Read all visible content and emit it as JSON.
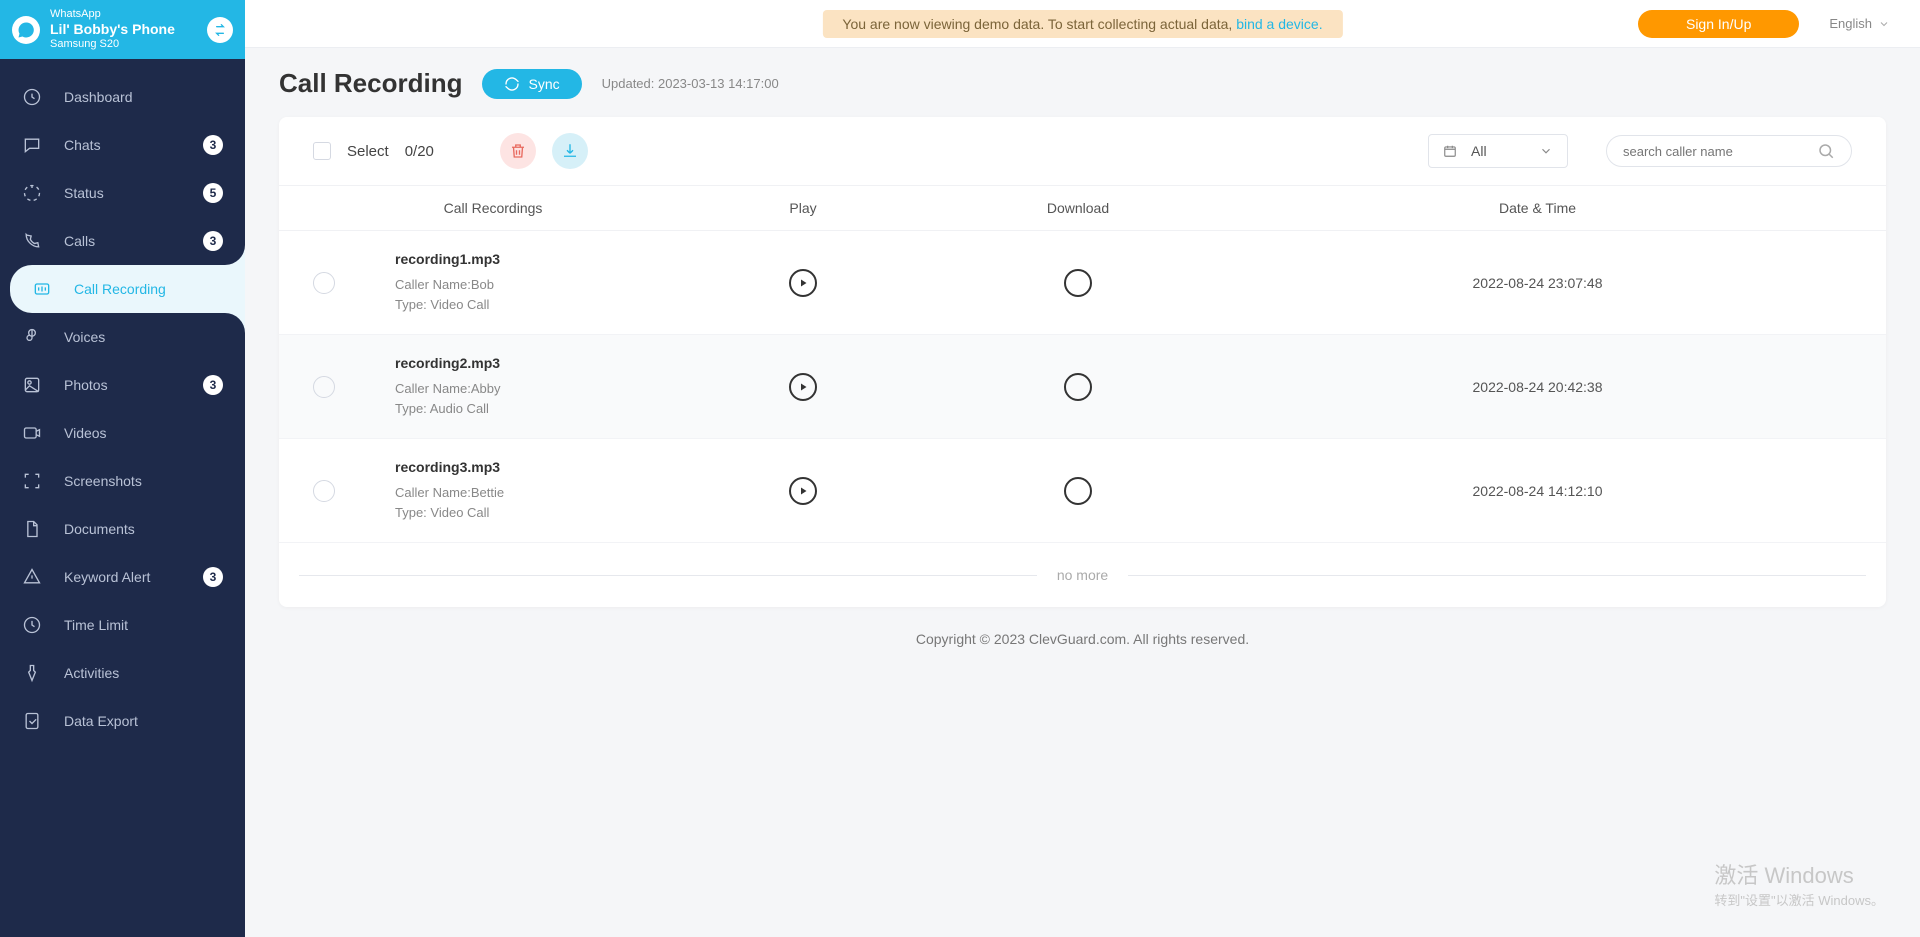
{
  "device": {
    "platform": "WhatsApp",
    "name": "Lil' Bobby's Phone",
    "model": "Samsung S20"
  },
  "demo": {
    "text": "You are now viewing demo data. To start collecting actual data, ",
    "link": "bind a device."
  },
  "header": {
    "signin": "Sign In/Up",
    "language": "English"
  },
  "sidebar": {
    "items": [
      {
        "label": "Dashboard",
        "badge": null
      },
      {
        "label": "Chats",
        "badge": "3"
      },
      {
        "label": "Status",
        "badge": "5"
      },
      {
        "label": "Calls",
        "badge": "3"
      },
      {
        "label": "Call Recording",
        "badge": null,
        "active": true
      },
      {
        "label": "Voices",
        "badge": null
      },
      {
        "label": "Photos",
        "badge": "3"
      },
      {
        "label": "Videos",
        "badge": null
      },
      {
        "label": "Screenshots",
        "badge": null
      },
      {
        "label": "Documents",
        "badge": null
      },
      {
        "label": "Keyword Alert",
        "badge": "3"
      },
      {
        "label": "Time Limit",
        "badge": null
      },
      {
        "label": "Activities",
        "badge": null
      },
      {
        "label": "Data Export",
        "badge": null
      }
    ]
  },
  "page": {
    "title": "Call Recording",
    "sync": "Sync",
    "updated": "Updated: 2023-03-13 14:17:00",
    "select_label": "Select",
    "select_count": "0/20",
    "filter": "All",
    "search_placeholder": "search caller name",
    "columns": {
      "rec": "Call Recordings",
      "play": "Play",
      "dl": "Download",
      "date": "Date & Time"
    },
    "caller_label": "Caller Name:",
    "type_label": "Type: ",
    "rows": [
      {
        "file": "recording1.mp3",
        "caller": "Bob",
        "type": "Video Call",
        "datetime": "2022-08-24 23:07:48"
      },
      {
        "file": "recording2.mp3",
        "caller": "Abby",
        "type": "Audio Call",
        "datetime": "2022-08-24 20:42:38"
      },
      {
        "file": "recording3.mp3",
        "caller": "Bettie",
        "type": "Video Call",
        "datetime": "2022-08-24 14:12:10"
      }
    ],
    "nomore": "no more"
  },
  "footer": "Copyright © 2023 ClevGuard.com. All rights reserved.",
  "watermark": {
    "l1": "激活 Windows",
    "l2": "转到\"设置\"以激活 Windows。"
  }
}
